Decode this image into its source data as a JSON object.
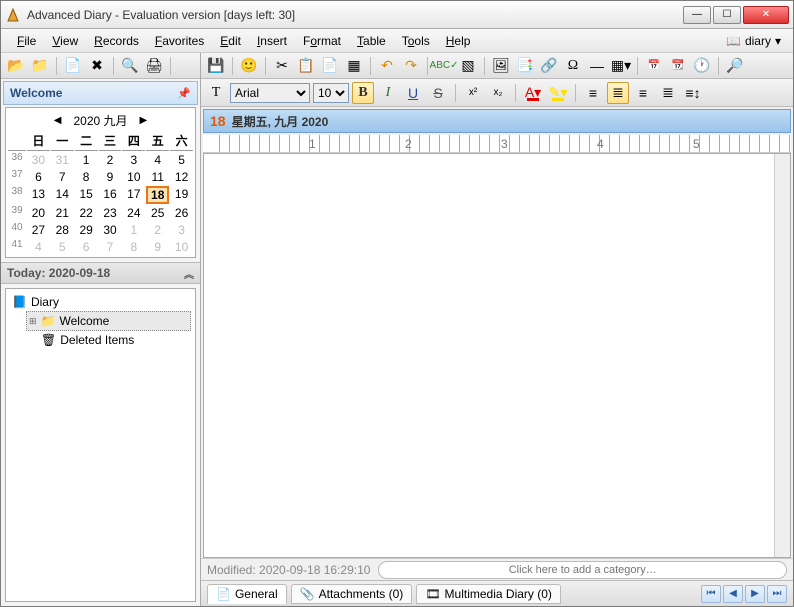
{
  "window": {
    "title": "Advanced Diary - Evaluation version [days left: 30]"
  },
  "menu": {
    "file": "File",
    "view": "View",
    "records": "Records",
    "favorites": "Favorites",
    "edit": "Edit",
    "insert": "Insert",
    "format": "Format",
    "table": "Table",
    "tools": "Tools",
    "help": "Help",
    "diary_btn": "diary"
  },
  "left": {
    "welcome_header": "Welcome",
    "calendar": {
      "month_label": "2020 九月",
      "day_headers": [
        "日",
        "一",
        "二",
        "三",
        "四",
        "五",
        "六"
      ],
      "weeks": [
        {
          "wk": 36,
          "days": [
            {
              "n": 30,
              "g": true
            },
            {
              "n": 31,
              "g": true
            },
            {
              "n": 1
            },
            {
              "n": 2
            },
            {
              "n": 3
            },
            {
              "n": 4
            },
            {
              "n": 5
            }
          ]
        },
        {
          "wk": 37,
          "days": [
            {
              "n": 6
            },
            {
              "n": 7
            },
            {
              "n": 8
            },
            {
              "n": 9
            },
            {
              "n": 10
            },
            {
              "n": 11
            },
            {
              "n": 12
            }
          ]
        },
        {
          "wk": 38,
          "days": [
            {
              "n": 13
            },
            {
              "n": 14
            },
            {
              "n": 15
            },
            {
              "n": 16
            },
            {
              "n": 17
            },
            {
              "n": 18,
              "t": true
            },
            {
              "n": 19
            }
          ]
        },
        {
          "wk": 39,
          "days": [
            {
              "n": 20
            },
            {
              "n": 21
            },
            {
              "n": 22
            },
            {
              "n": 23
            },
            {
              "n": 24
            },
            {
              "n": 25
            },
            {
              "n": 26
            }
          ]
        },
        {
          "wk": 40,
          "days": [
            {
              "n": 27
            },
            {
              "n": 28
            },
            {
              "n": 29
            },
            {
              "n": 30
            },
            {
              "n": 1,
              "g": true
            },
            {
              "n": 2,
              "g": true
            },
            {
              "n": 3,
              "g": true
            }
          ]
        },
        {
          "wk": 41,
          "days": [
            {
              "n": 4,
              "g": true
            },
            {
              "n": 5,
              "g": true
            },
            {
              "n": 6,
              "g": true
            },
            {
              "n": 7,
              "g": true
            },
            {
              "n": 8,
              "g": true
            },
            {
              "n": 9,
              "g": true
            },
            {
              "n": 10,
              "g": true
            }
          ]
        }
      ]
    },
    "today_label": "Today: 2020-09-18",
    "tree": {
      "root": "Diary",
      "welcome": "Welcome",
      "deleted": "Deleted Items"
    }
  },
  "format_toolbar": {
    "font": "Arial",
    "size": "10"
  },
  "datebar": {
    "day_num": "18",
    "day_text": "星期五, 九月 2020"
  },
  "ruler": {
    "marks": [
      "1",
      "2",
      "3",
      "4",
      "5"
    ]
  },
  "status": {
    "modified": "Modified: 2020-09-18 16:29:10",
    "category_placeholder": "Click here to add a category…"
  },
  "tabs": {
    "general": "General",
    "attachments": "Attachments (0)",
    "multimedia": "Multimedia Diary (0)"
  }
}
